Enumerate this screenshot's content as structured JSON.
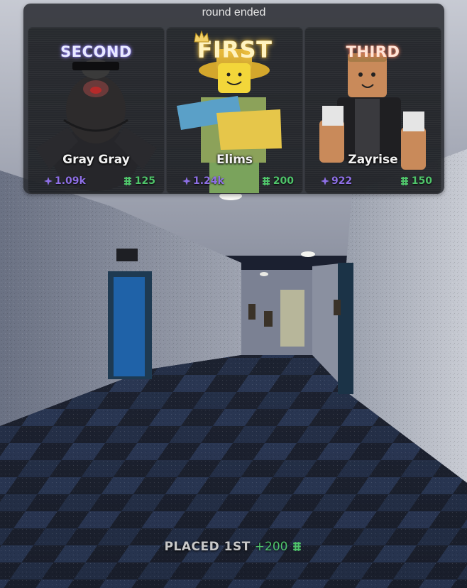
{
  "round_panel": {
    "title": "round ended",
    "cards": [
      {
        "place_label": "SECOND",
        "player": "Gray Gray",
        "gems": "1.09k",
        "cash": "125"
      },
      {
        "place_label": "FIRST",
        "player": "Elims",
        "gems": "1.24k",
        "cash": "200"
      },
      {
        "place_label": "THIRD",
        "player": "Zayrise",
        "gems": "922",
        "cash": "150"
      }
    ]
  },
  "footer": {
    "placed_label": "PLACED 1ST",
    "reward": "+200"
  },
  "icons": {
    "gem": "sparkle-gem-icon",
    "cash": "cash-icon",
    "crown": "crown-icon"
  },
  "colors": {
    "gem": "#8e6fe6",
    "cash": "#4fc46a",
    "second_glow": "#6a5cff",
    "first_glow": "#ffd250",
    "third_glow": "#ff8c6e"
  }
}
